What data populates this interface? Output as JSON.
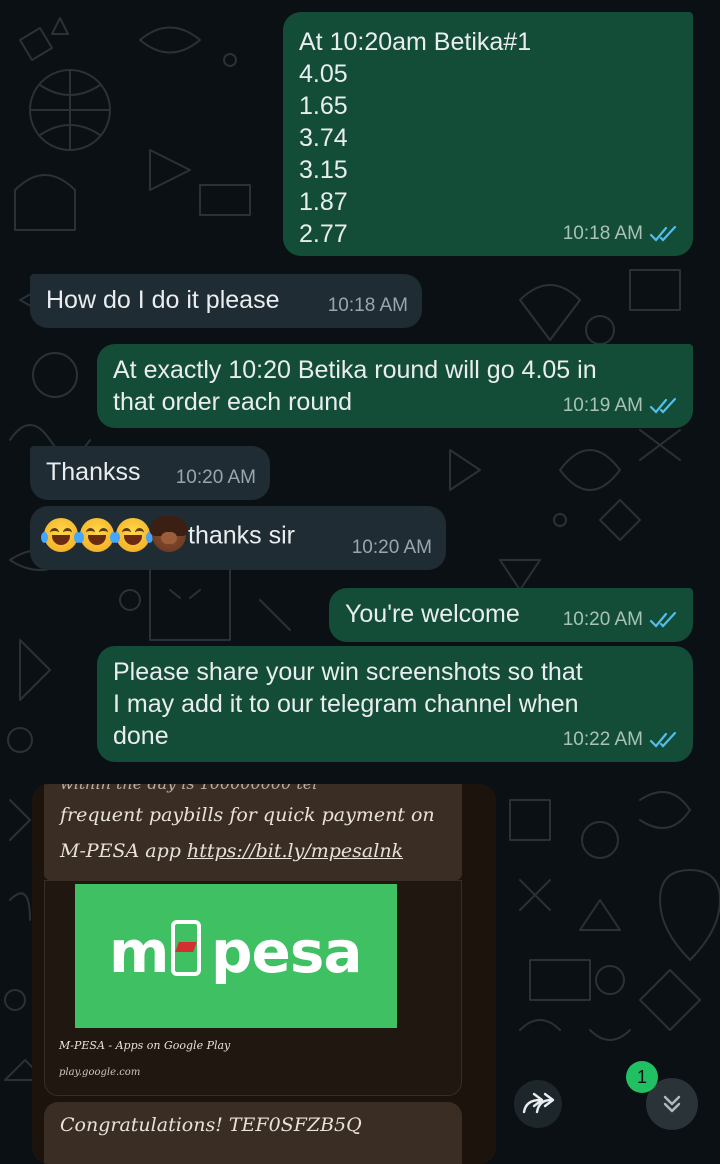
{
  "theme": {
    "background": "#0b1014",
    "outgoing_bubble": "#144d37",
    "incoming_bubble": "#1f2c33",
    "tick_color": "#53bdeb",
    "mpesa_green": "#3fc062"
  },
  "messages": [
    {
      "direction": "outgoing",
      "lines": [
        "At 10:20am Betika#1",
        "4.05",
        "1.65",
        "3.74",
        "3.15",
        "1.87",
        "2.77"
      ],
      "time": "10:18 AM",
      "status": "read"
    },
    {
      "direction": "incoming",
      "text": "How do I do it please",
      "time": "10:18 AM"
    },
    {
      "direction": "outgoing",
      "lines": [
        "At exactly 10:20 Betika round will go 4.05 in",
        "that order each round"
      ],
      "time": "10:19 AM",
      "status": "read"
    },
    {
      "direction": "incoming",
      "text": "Thankss",
      "time": "10:20 AM"
    },
    {
      "direction": "incoming",
      "emojis": [
        "face-with-tears-of-joy",
        "face-with-tears-of-joy",
        "face-with-tears-of-joy",
        "person-facepalming"
      ],
      "text": "thanks sir",
      "time": "10:20 AM"
    },
    {
      "direction": "outgoing",
      "text": "You're welcome",
      "time": "10:20 AM",
      "status": "read"
    },
    {
      "direction": "outgoing",
      "lines": [
        "Please share your win screenshots so that",
        "I may add it to our telegram channel when",
        "done"
      ],
      "time": "10:22 AM",
      "status": "read"
    }
  ],
  "media": {
    "cut_text": "within the day is 100000000 tel",
    "line1": "frequent paybills for quick payment on",
    "line2_prefix": "M-PESA app ",
    "link": "https://bit.ly/mpesalnk",
    "logo_m": "m",
    "logo_pesa": "pesa",
    "link_title": "M-PESA - Apps on Google Play",
    "link_domain": "play.google.com",
    "congrats": "Congratulations! TEF0SFZB5Q"
  },
  "unread_count": "1",
  "icons": {
    "forward": "forward-icon",
    "scroll_down": "double-chevron-down-icon",
    "read_ticks": "double-check-icon"
  }
}
